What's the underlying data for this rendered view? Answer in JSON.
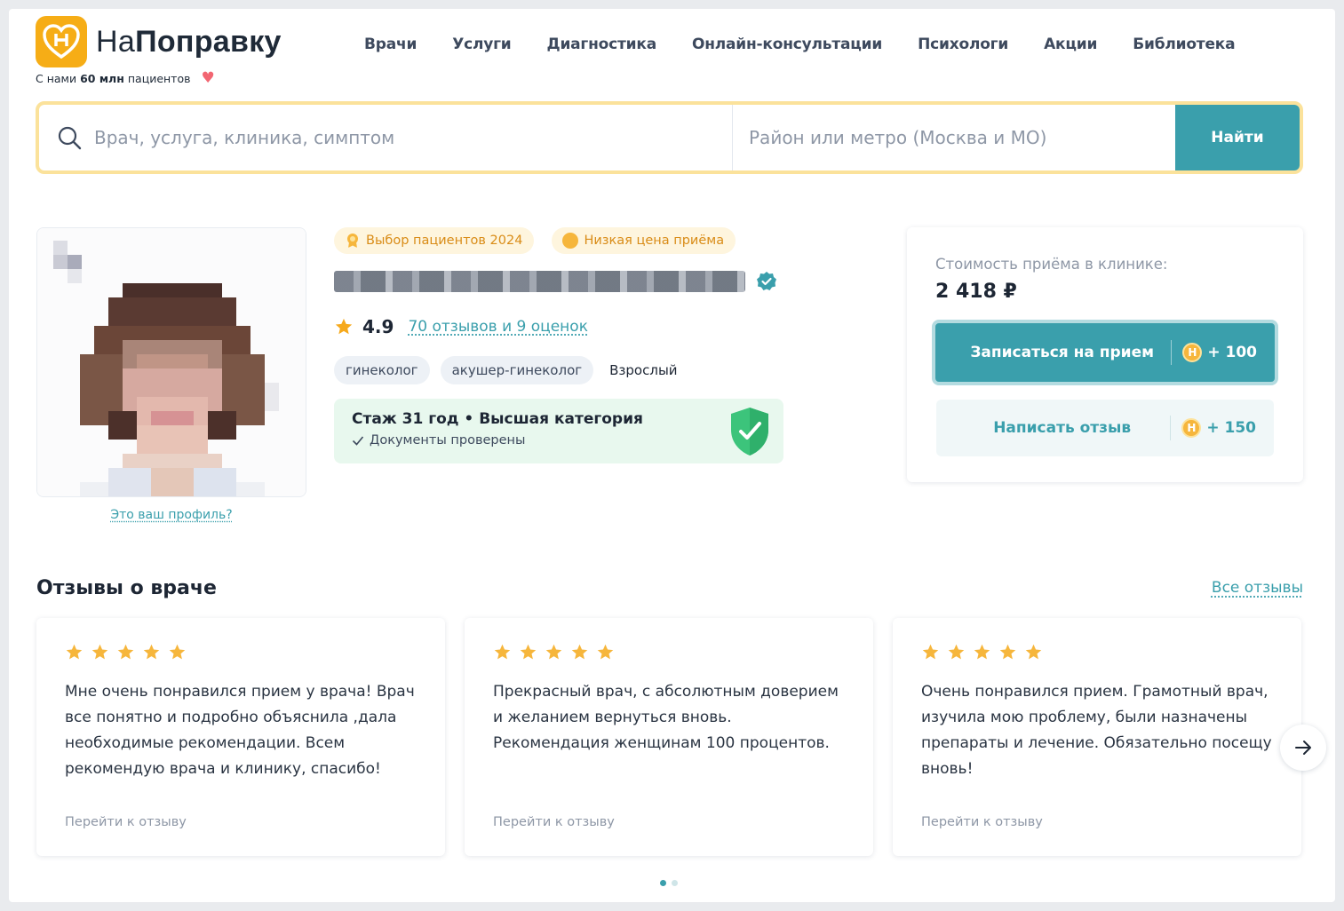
{
  "header": {
    "logo_prefix": "На",
    "logo_bold": "Поправку",
    "tagline_pre": "С нами",
    "tagline_bold": "60 млн",
    "tagline_post": "пациентов",
    "nav": [
      "Врачи",
      "Услуги",
      "Диагностика",
      "Онлайн-консультации",
      "Психологи",
      "Акции",
      "Библиотека"
    ]
  },
  "search": {
    "main_placeholder": "Врач, услуга, клиника, симптом",
    "location_placeholder": "Район или метро (Москва и МО)",
    "button_label": "Найти"
  },
  "doctor": {
    "profile_link": "Это ваш профиль?",
    "badges": [
      "Выбор пациентов 2024",
      "Низкая цена приёма"
    ],
    "rating": "4.9",
    "reviews_link": "70 отзывов и 9 оценок",
    "tags": [
      "гинеколог",
      "акушер-гинеколог"
    ],
    "age_group": "Взрослый",
    "experience_title": "Стаж 31 год • Высшая категория",
    "documents_status": "Документы проверены"
  },
  "booking": {
    "price_label": "Стоимость приёма в клинике:",
    "price_value": "2 418 ₽",
    "book_label": "Записаться на прием",
    "book_bonus": "+ 100",
    "review_label": "Написать отзыв",
    "review_bonus": "+ 150",
    "coin_letter": "Н"
  },
  "reviews": {
    "title": "Отзывы о враче",
    "all_link": "Все отзывы",
    "items": [
      {
        "rating": 5,
        "text": "Мне очень понравился прием у врача! Врач все понятно и подробно объяснила ,дала необходимые рекомендации. Всем рекомендую врача и клинику, спасибо!",
        "link": "Перейти к отзыву"
      },
      {
        "rating": 5,
        "text": "Прекрасный врач, с абсолютным доверием и желанием вернуться вновь. Рекомендация женщинам 100 процентов.",
        "link": "Перейти к отзыву"
      },
      {
        "rating": 5,
        "text": "Очень понравился прием. Грамотный врач, изучила мою проблему, были назначены препараты и лечение. Обязательно посещу вновь!",
        "link": "Перейти к отзыву"
      }
    ],
    "pagination": {
      "pages": 2,
      "current": 1
    }
  },
  "colors": {
    "accent": "#3a9fac",
    "brand_orange": "#f6ad16",
    "star": "#f6b63c",
    "search_border": "#fbe29b"
  }
}
